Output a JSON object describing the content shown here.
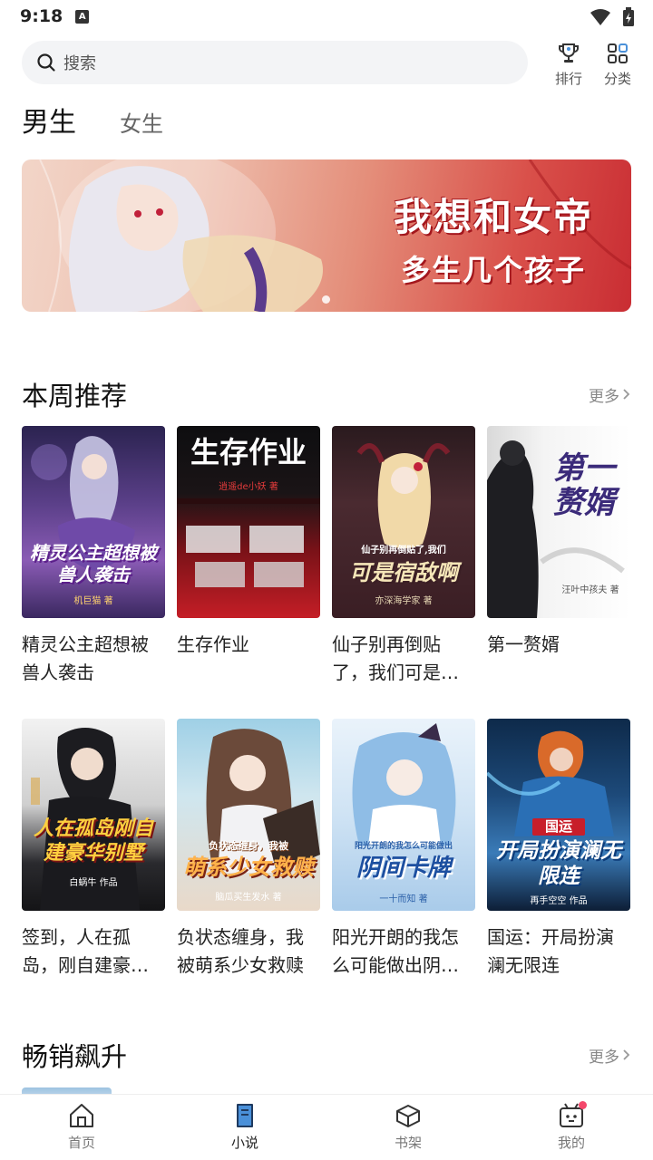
{
  "status_bar": {
    "time": "9:18",
    "notification_icon": "a-box-icon",
    "wifi_icon": "wifi-icon",
    "battery_icon": "battery-charging-icon"
  },
  "search": {
    "placeholder": "搜索"
  },
  "top_actions": [
    {
      "label": "排行",
      "icon": "trophy-icon"
    },
    {
      "label": "分类",
      "icon": "grid-icon"
    }
  ],
  "gender_tabs": {
    "active": "男生",
    "inactive": "女生"
  },
  "banner": {
    "line1": "我想和女帝",
    "line2": "多生几个孩子",
    "pages": 1,
    "current_page": 1
  },
  "weekly": {
    "title": "本周推荐",
    "more": "更多",
    "books": [
      {
        "name": "精灵公主超想被兽人袭击",
        "cover_title": "精灵公主超想被兽人袭击",
        "cover_author": "机巨猫 著"
      },
      {
        "name": "生存作业",
        "cover_title": "生存作业",
        "cover_author": "逍遥de小妖 著"
      },
      {
        "name": "仙子别再倒贴了，我们可是宿敌啊",
        "cover_title": "可是宿敌啊",
        "cover_subtitle": "仙子别再倒贴了,我们",
        "cover_author": "亦深海学家 著"
      },
      {
        "name": "第一赘婿",
        "cover_title": "第一赘婿",
        "cover_author": "汪叶中孩夫 著"
      },
      {
        "name": "签到，人在孤岛，刚自建豪华别墅",
        "cover_title": "人在孤岛刚自建豪华别墅",
        "cover_author": "白蜗牛 作品"
      },
      {
        "name": "负状态缠身，我被萌系少女救赎",
        "cover_title": "萌系少女救赎",
        "cover_subtitle": "负状态缠身，我被",
        "cover_author": "脑瓜买生发水 著"
      },
      {
        "name": "阳光开朗的我怎么可能做出阴间卡牌",
        "cover_title": "阴间卡牌",
        "cover_subtitle": "阳光开朗的我怎么可能做出",
        "cover_author": "一十而知 著"
      },
      {
        "name": "国运：开局扮演澜无限连",
        "cover_title": "开局扮演澜无限连",
        "cover_subtitle": "国运",
        "cover_author": "再手空空 作品"
      }
    ]
  },
  "bestseller": {
    "title": "畅销飙升",
    "more": "更多"
  },
  "bottom_nav": [
    {
      "label": "首页",
      "icon": "house-icon",
      "active": false
    },
    {
      "label": "小说",
      "icon": "book-icon",
      "active": true
    },
    {
      "label": "书架",
      "icon": "bookshelf-box-icon",
      "active": false
    },
    {
      "label": "我的",
      "icon": "robot-face-icon",
      "active": false,
      "badge_dot": true
    }
  ],
  "colors": {
    "accent_blue": "#4a90d9",
    "badge_red": "#f4476b",
    "text_primary": "#222222",
    "text_secondary": "#888888"
  }
}
